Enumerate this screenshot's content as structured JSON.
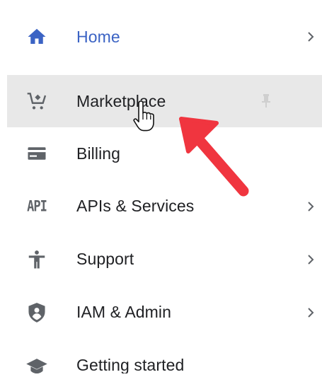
{
  "nav": {
    "items": [
      {
        "label": "Home",
        "icon": "home-icon",
        "has_chevron": true
      },
      {
        "label": "Marketplace",
        "icon": "cart-icon",
        "has_chevron": false,
        "active": true,
        "pinned": true
      },
      {
        "label": "Billing",
        "icon": "billing-card-icon",
        "has_chevron": false
      },
      {
        "label": "APIs & Services",
        "icon": "api-icon",
        "icon_text": "API",
        "has_chevron": true
      },
      {
        "label": "Support",
        "icon": "support-person-icon",
        "has_chevron": true
      },
      {
        "label": "IAM & Admin",
        "icon": "shield-user-icon",
        "has_chevron": true
      },
      {
        "label": "Getting started",
        "icon": "graduation-cap-icon",
        "has_chevron": false
      }
    ]
  },
  "colors": {
    "home_accent": "#3b63c4",
    "icon_gray": "#5f6368",
    "active_bg": "#e8e8e8",
    "annotation_arrow": "#f0353f"
  }
}
